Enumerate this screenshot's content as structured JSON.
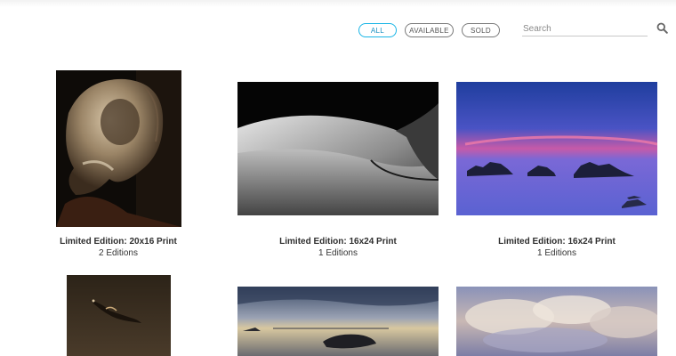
{
  "filters": [
    {
      "label": "ALL",
      "active": true
    },
    {
      "label": "AVAILABLE",
      "active": false
    },
    {
      "label": "SOLD",
      "active": false
    }
  ],
  "search": {
    "placeholder": "Search",
    "icon": "search-icon"
  },
  "accent_color": "#19b5e6",
  "gallery": [
    {
      "title": "Limited Edition: 20x16 Print",
      "editions": "2 Editions"
    },
    {
      "title": "Limited Edition: 16x24 Print",
      "editions": "1 Editions"
    },
    {
      "title": "Limited Edition: 16x24 Print",
      "editions": "1 Editions"
    },
    {
      "title": "",
      "editions": ""
    },
    {
      "title": "",
      "editions": ""
    },
    {
      "title": "",
      "editions": ""
    }
  ]
}
